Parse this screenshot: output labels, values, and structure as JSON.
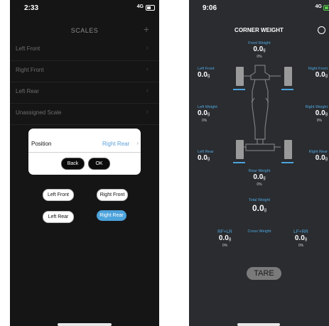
{
  "scales_screen": {
    "status": {
      "time": "2:33",
      "network": "4G"
    },
    "title": "SCALES",
    "add_icon": "plus-icon",
    "rows": [
      {
        "label": "Left Front"
      },
      {
        "label": "Right Front"
      },
      {
        "label": "Left Rear"
      },
      {
        "label": "Unassigned Scale"
      }
    ],
    "dialog": {
      "position_label": "Position",
      "position_value": "Right Rear",
      "back_label": "Back",
      "ok_label": "OK"
    },
    "position_buttons": [
      {
        "label": "Left Front",
        "selected": false
      },
      {
        "label": "Right Front",
        "selected": false
      },
      {
        "label": "Left Rear",
        "selected": false
      },
      {
        "label": "Right Rear",
        "selected": true
      }
    ]
  },
  "corner_screen": {
    "status": {
      "time": "9:06",
      "network": "4G"
    },
    "title": "CORNER WEIGHT",
    "settings_icon": "gear-icon",
    "unit": "g",
    "front_weight": {
      "label": "Front Weight",
      "value": "0.0",
      "pct": "0%"
    },
    "left_front": {
      "label": "Left Front",
      "value": "0.0"
    },
    "right_front": {
      "label": "Right Front",
      "value": "0.0"
    },
    "left_weight": {
      "label": "Left Weight",
      "value": "0.0",
      "pct": "0%"
    },
    "right_weight": {
      "label": "Right Weight",
      "value": "0.0",
      "pct": "0%"
    },
    "left_rear": {
      "label": "Left Rear",
      "value": "0.0"
    },
    "right_rear": {
      "label": "Right Rear",
      "value": "0.0"
    },
    "rear_weight": {
      "label": "Rear Weight",
      "value": "0.0",
      "pct": "0%"
    },
    "total_weight": {
      "label": "Total Weight",
      "value": "0.0"
    },
    "rf_lr": {
      "label": "RF+LR",
      "value": "0.0",
      "pct": "0%"
    },
    "cross_weight": {
      "label": "Cross Weight"
    },
    "lf_rr": {
      "label": "LF+RR",
      "value": "0.0",
      "pct": "0%"
    },
    "tare_label": "TARE",
    "colors": {
      "accent": "#4da3dc",
      "battery": "#57c84d"
    }
  }
}
